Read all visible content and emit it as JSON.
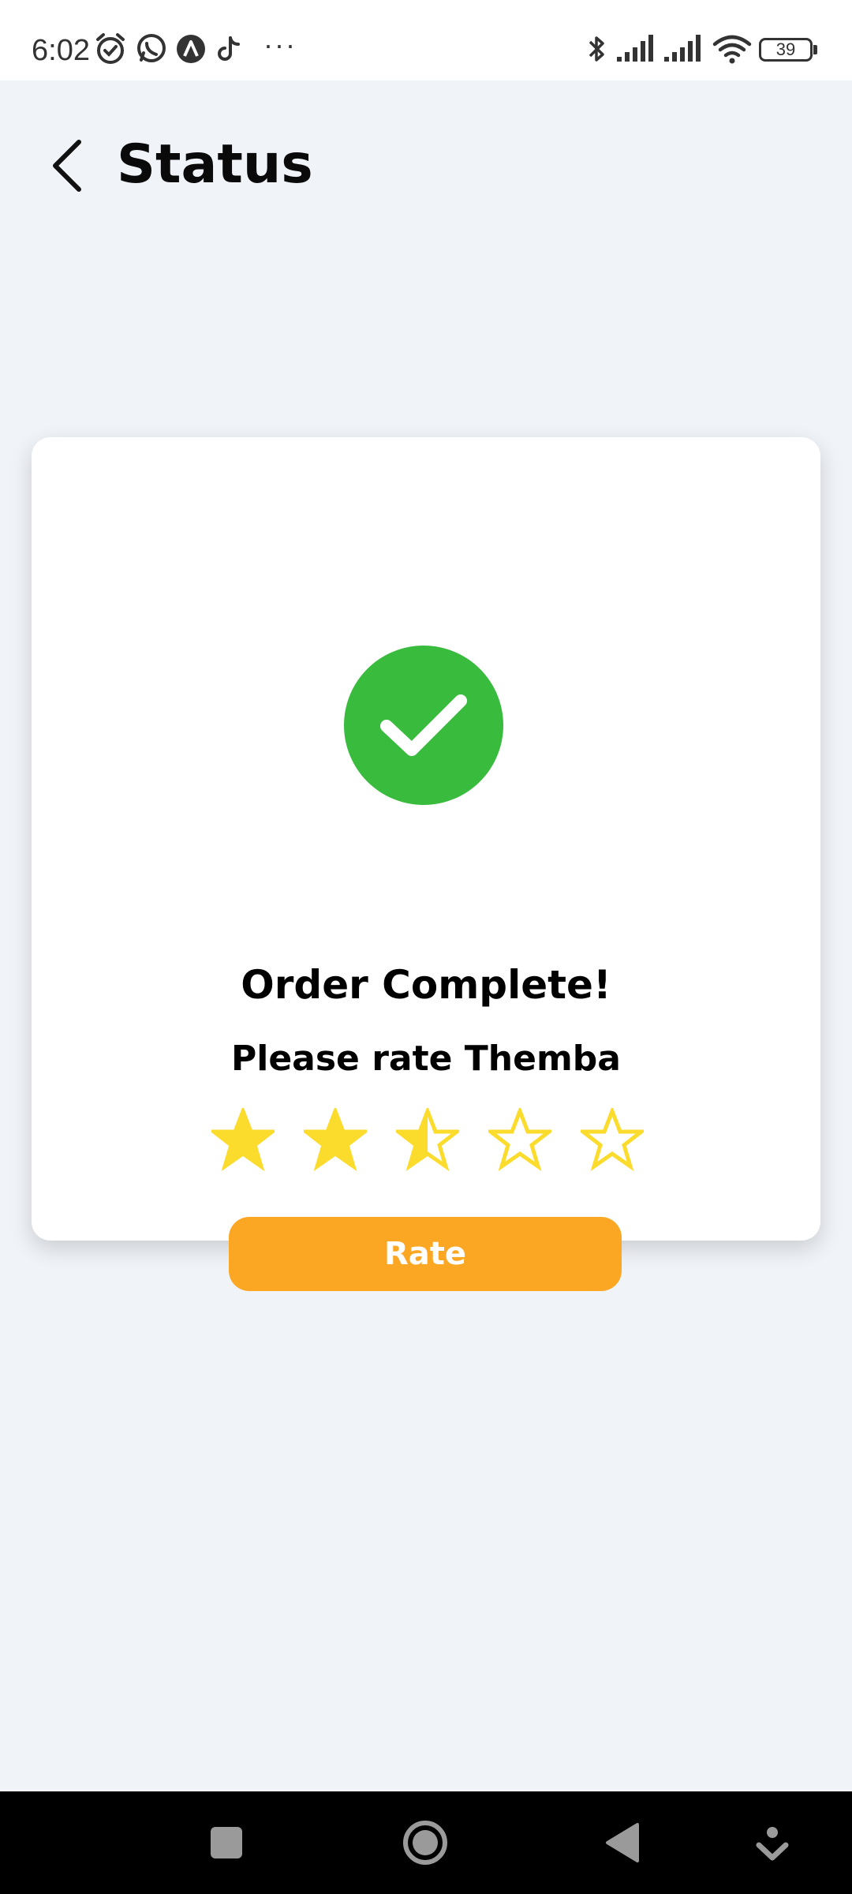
{
  "status_bar": {
    "time": "6:02",
    "battery_level": "39",
    "more": "···",
    "icons": [
      "alarm-icon",
      "whatsapp-icon",
      "app-icon",
      "tiktok-icon",
      "bluetooth-icon",
      "signal-icon",
      "signal-icon",
      "wifi-icon",
      "battery-icon"
    ]
  },
  "header": {
    "title": "Status",
    "back_icon": "chevron-left-icon"
  },
  "card": {
    "status_icon": "checkmark-icon",
    "title": "Order Complete!",
    "prompt": "Please rate Themba",
    "rating": {
      "value": 2.5,
      "max": 5
    },
    "button_label": "Rate"
  },
  "nav_bar": {
    "buttons": [
      "recents-icon",
      "home-icon",
      "back-icon",
      "assistant-icon"
    ]
  },
  "colors": {
    "background": "#f0f3f8",
    "card": "#ffffff",
    "success": "#39bb3e",
    "star": "#fbdb2c",
    "button": "#fca724"
  }
}
